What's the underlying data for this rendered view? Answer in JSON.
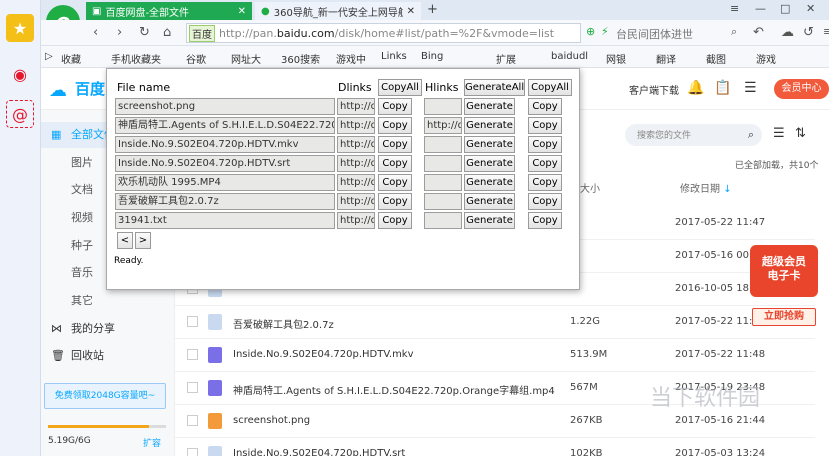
{
  "browser": {
    "tabs": [
      {
        "label": "百度网盘-全部文件",
        "active": true
      },
      {
        "label": "360导航_新一代安全上网导航",
        "active": false
      }
    ],
    "url": {
      "badge": "百度",
      "prefix": "http://pan.",
      "domain": "baidu.com",
      "path": "/disk/home#list/path=%2F&vmode=list"
    },
    "search_text": "台民间团体进世",
    "bookmarks": [
      "收藏",
      "手机收藏夹",
      "谷歌",
      "网址大",
      "360搜索",
      "游戏中",
      "Links",
      "Bing",
      "扩展",
      "baidudl",
      "网银",
      "翻译",
      "截图",
      "游戏"
    ]
  },
  "pan": {
    "logo": "百度",
    "client_download": "客户端下载",
    "vip_button": "会员中心",
    "sidebar": {
      "items": [
        {
          "label": "全部文件",
          "active": true
        },
        {
          "label": "图片"
        },
        {
          "label": "文档"
        },
        {
          "label": "视频"
        },
        {
          "label": "种子"
        },
        {
          "label": "音乐"
        },
        {
          "label": "其它"
        },
        {
          "label": "我的分享"
        },
        {
          "label": "回收站"
        }
      ],
      "free_space": "免费领取2048G容量吧~",
      "quota_fraction": 0.86,
      "quota": "5.19G/6G",
      "expand": "扩容"
    },
    "search_placeholder": "搜索您的文件",
    "loaded_text": "已全部加载，共10个",
    "columns": {
      "size": "大小",
      "date": "修改日期"
    },
    "files": [
      {
        "name": "",
        "size": "",
        "date": "2017-05-22 11:47",
        "type": "folder"
      },
      {
        "name": "",
        "size": "",
        "date": "2017-05-16 00:04",
        "type": "folder"
      },
      {
        "name": "",
        "size": "",
        "date": "2016-10-05 18:55",
        "type": "folder"
      },
      {
        "name": "吾爱破解工具包2.0.7z",
        "size": "1.22G",
        "date": "2017-05-22 11:48",
        "type": "zip"
      },
      {
        "name": "Inside.No.9.S02E04.720p.HDTV.mkv",
        "size": "513.9M",
        "date": "2017-05-22 11:48",
        "type": "video"
      },
      {
        "name": "神盾局特工.Agents of S.H.I.E.L.D.S04E22.720p.Orange字幕组.mp4",
        "size": "567M",
        "date": "2017-05-19 23:48",
        "type": "video"
      },
      {
        "name": "screenshot.png",
        "size": "267KB",
        "date": "2017-05-16 21:44",
        "type": "image"
      },
      {
        "name": "Inside.No.9.S02E04.720p.HDTV.srt",
        "size": "102KB",
        "date": "2017-05-03 13:24",
        "type": "doc"
      }
    ],
    "promo": {
      "line1": "超级会员",
      "line2": "电子卡",
      "buy": "立即抢购"
    },
    "watermark": "当下软件园"
  },
  "popup": {
    "file_name_header": "File name",
    "dlinks_header": "Dlinks",
    "copyall_label": "CopyAll",
    "hlinks_header": "Hlinks",
    "generateall_label": "GenerateAll",
    "copy_label": "Copy",
    "generate_label": "Generate",
    "rows": [
      {
        "name": "screenshot.png",
        "dlink": "http://d.",
        "hlink": ""
      },
      {
        "name": "神盾局特工.Agents of S.H.I.E.L.D.S04E22.720p.Or:",
        "dlink": "http://d.",
        "hlink": "http://d."
      },
      {
        "name": "Inside.No.9.S02E04.720p.HDTV.mkv",
        "dlink": "http://d.",
        "hlink": ""
      },
      {
        "name": "Inside.No.9.S02E04.720p.HDTV.srt",
        "dlink": "http://d.",
        "hlink": ""
      },
      {
        "name": "欢乐机动队 1995.MP4",
        "dlink": "http://d.",
        "hlink": ""
      },
      {
        "name": "吾爱破解工具包2.0.7z",
        "dlink": "http://d.",
        "hlink": ""
      },
      {
        "name": "31941.txt",
        "dlink": "http://d.",
        "hlink": ""
      }
    ],
    "prev": "<",
    "next": ">",
    "status": "Ready."
  }
}
